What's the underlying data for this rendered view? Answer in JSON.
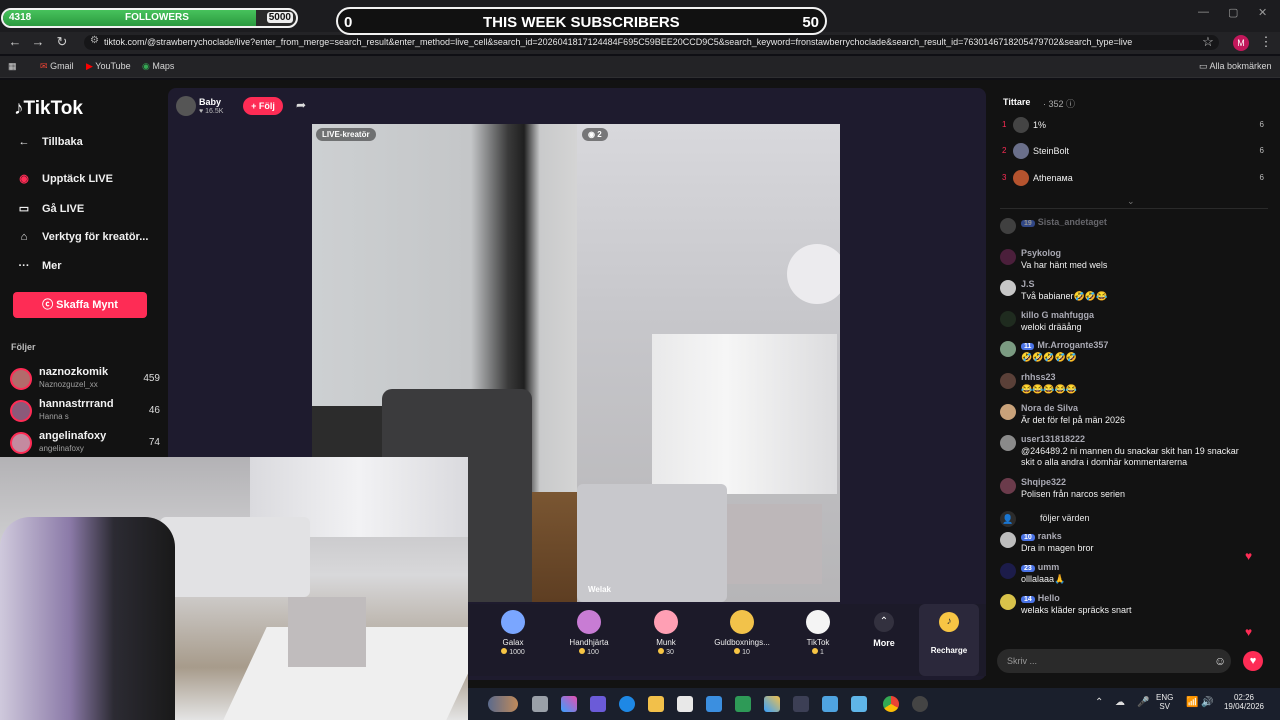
{
  "overlay": {
    "followers": {
      "current": "4318",
      "label": "FOLLOWERS",
      "goal": "5000",
      "progress": 0.864
    },
    "subscribers": {
      "current": "0",
      "label": "THIS WEEK SUBSCRIBERS",
      "goal": "50"
    }
  },
  "browser": {
    "url": "tiktok.com/@strawberrychoclade/live?enter_from_merge=search_result&enter_method=live_cell&search_id=2026041817124484F695C59BEE20CCD9C5&search_keyword=fronstawberrychoclade&search_result_id=7630146718205479702&search_type=live",
    "profile_initial": "M",
    "bookmarks": [
      {
        "label": "Gmail"
      },
      {
        "label": "YouTube"
      },
      {
        "label": "Maps"
      }
    ],
    "all_bookmarks": "Alla bokmärken"
  },
  "sidebar": {
    "logo": "TikTok",
    "items": [
      {
        "label": "Tillbaka"
      },
      {
        "label": "Upptäck LIVE"
      },
      {
        "label": "Gå LIVE"
      },
      {
        "label": "Verktyg för kreatör..."
      },
      {
        "label": "Mer"
      }
    ],
    "coins_button": "Skaffa Mynt",
    "following_title": "Följer",
    "following": [
      {
        "name": "naznozkomik",
        "sub": "Naznozguzel_xx",
        "count": "459"
      },
      {
        "name": "hannastrrrand",
        "sub": "Hanna s",
        "count": "46"
      },
      {
        "name": "angelinafoxy",
        "sub": "angelinafoxy",
        "count": "74"
      }
    ]
  },
  "live": {
    "host": {
      "name": "Baby",
      "likes": "16.5K"
    },
    "follow_button": "+ Följ",
    "left_badge": "LIVE-kreatör",
    "right_badge": "2",
    "right_name": "Welak"
  },
  "gifts": [
    {
      "name": "Galax",
      "price": "1000",
      "color": "#7aa6ff"
    },
    {
      "name": "Handhjärta",
      "price": "100",
      "color": "#c87cd4"
    },
    {
      "name": "Munk",
      "price": "30",
      "color": "#ff9fb4"
    },
    {
      "name": "Guldboxnings...",
      "price": "10",
      "color": "#f2c24a"
    },
    {
      "name": "TikTok",
      "price": "1",
      "color": "#f4f4f4"
    }
  ],
  "gift_more": "More",
  "recharge": "Recharge",
  "viewers": {
    "title": "Tittare",
    "count": "· 352",
    "ranks": [
      {
        "num": "1",
        "name": "1%",
        "score": "6"
      },
      {
        "num": "2",
        "name": "SteinBolt",
        "score": "6"
      },
      {
        "num": "3",
        "name": "Athenaмa",
        "score": "6"
      }
    ]
  },
  "chat": [
    {
      "user": "Sista_andetaget",
      "level": "19",
      "text": ""
    },
    {
      "user": "Psykolog",
      "level": "",
      "text": "Va har hänt med wels"
    },
    {
      "user": "J.S",
      "level": "",
      "text": "Två babianer🤣🤣😂"
    },
    {
      "user": "killo G mahfugga",
      "level": "",
      "text": "weloki drääång"
    },
    {
      "user": "Mr.Arrogante357",
      "level": "11",
      "text": "🤣🤣🤣🤣🤣"
    },
    {
      "user": "rhhss23",
      "level": "",
      "text": "😂😂😂😂😂"
    },
    {
      "user": "Nora de Silva",
      "level": "",
      "text": "Är det för fel på män 2026"
    },
    {
      "user": "user131818222",
      "level": "",
      "text": "@246489.2 ni mannen du snackar skit han 19 snackar skit o alla andra i domhär kommentarerna"
    },
    {
      "user": "Shqipe322",
      "level": "",
      "text": "Polisen från narcos serien"
    },
    {
      "user": "",
      "level": "",
      "text": "följer värden"
    },
    {
      "user": "ranks",
      "level": "10",
      "text": "Dra in magen bror"
    },
    {
      "user": "umm",
      "level": "23",
      "text": "olllalaaa🙏"
    },
    {
      "user": "Hello",
      "level": "14",
      "text": "welaks kläder spräcks snart"
    }
  ],
  "chat_input_placeholder": "Skriv ...",
  "taskbar": {
    "lang": "ENG",
    "lang_sub": "SV",
    "time": "02:26",
    "date": "19/04/2026"
  }
}
